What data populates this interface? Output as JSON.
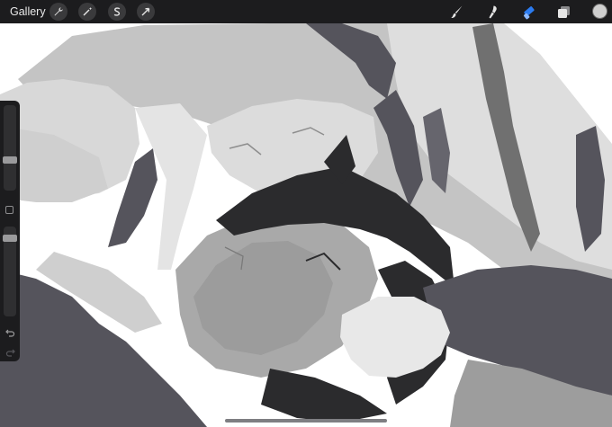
{
  "topbar": {
    "gallery_label": "Gallery",
    "left_tools": [
      {
        "name": "actions",
        "icon": "wrench-icon"
      },
      {
        "name": "adjustments",
        "icon": "magic-wand-icon"
      },
      {
        "name": "selection",
        "icon": "selection-s-icon"
      },
      {
        "name": "transform",
        "icon": "arrow-cursor-icon"
      }
    ],
    "right_tools": [
      {
        "name": "brush",
        "icon": "brush-icon",
        "active": false
      },
      {
        "name": "smudge",
        "icon": "smudge-icon",
        "active": false
      },
      {
        "name": "eraser",
        "icon": "eraser-icon",
        "active": true
      },
      {
        "name": "layers",
        "icon": "layers-icon",
        "active": false
      }
    ],
    "current_color": "#cfcfcf"
  },
  "sidebar": {
    "brush_size_level": 0.35,
    "opacity_level": 0.9,
    "modify_button_icon": "square-icon",
    "undo_icon": "undo-icon",
    "redo_icon": "redo-icon"
  },
  "colors": {
    "accent": "#2b7bf0",
    "toolbar_bg": "#1c1c1e",
    "canvas_bg": "#ffffff"
  }
}
